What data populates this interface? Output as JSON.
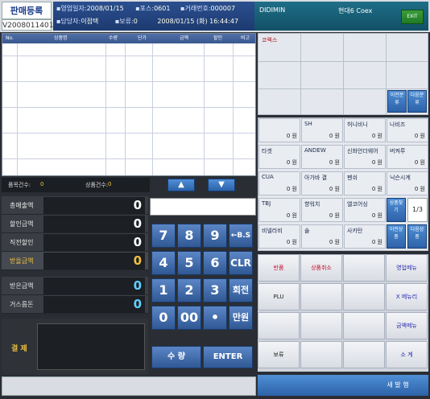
{
  "header": {
    "title": "판매등록",
    "code": "V2008011401",
    "info": [
      {
        "label": "▪영업일자:",
        "value": "2008/01/15"
      },
      {
        "label": "▪포스:",
        "value": "0601"
      },
      {
        "label": "▪거래번호:",
        "value": "000007"
      },
      {
        "label": "▪담당자:",
        "value": "이점택"
      },
      {
        "label": "▪보류:",
        "value": "0"
      },
      {
        "label": "",
        "value": "2008/01/15 (화) 16:44:47"
      }
    ],
    "store": "DIDIMIN",
    "branch": "현대6 Coex",
    "corner_label": "EXIT"
  },
  "table": {
    "columns": [
      "No.",
      "상품명",
      "수량",
      "단가",
      "금액",
      "할인",
      "비고"
    ]
  },
  "counts": {
    "items_label": "품목건수:",
    "items_value": "0",
    "qty_label": "상품건수:",
    "qty_value": "0"
  },
  "amounts": [
    {
      "label": "총매출액",
      "value": "0",
      "color": "#ffffff"
    },
    {
      "label": "할인금액",
      "value": "0",
      "color": "#ffffff"
    },
    {
      "label": "직전할인",
      "value": "0",
      "color": "#ffffff"
    },
    {
      "label": "받을금액",
      "value": "0",
      "color": "#f0c040"
    },
    {
      "label": "받은금액",
      "value": "0",
      "color": "#5fd0ff"
    },
    {
      "label": "거스름돈",
      "value": "0",
      "color": "#5fd0ff"
    }
  ],
  "payment_label": "결 제",
  "keypad": {
    "row1": [
      "7",
      "8",
      "9",
      "←B.S"
    ],
    "row2": [
      "4",
      "5",
      "6",
      "CLR"
    ],
    "row3": [
      "1",
      "2",
      "3",
      "회전"
    ],
    "row4": [
      "0",
      "00",
      "•",
      "만원"
    ],
    "qty": "수 량",
    "enter": "ENTER"
  },
  "category": {
    "title": "코렉스"
  },
  "categorynav": {
    "prev": "이전분류",
    "next": "다음분류"
  },
  "products": [
    [
      "",
      "SH",
      "허니비니",
      "나비즈"
    ],
    [
      "타겟",
      "ANDEW",
      "신화언더웨어",
      "버켜루"
    ],
    [
      "CUA",
      "아가바 결",
      "펜쉬",
      "닉슨시계"
    ],
    [
      "TBJ",
      "향워치",
      "엘코어싱",
      ""
    ],
    [
      "비넬라비",
      "솔",
      "사카탄",
      ""
    ]
  ],
  "product_price": "0 원",
  "pagenav": {
    "prev": "상품찾기",
    "page": "1",
    "total": "3"
  },
  "productnav": {
    "prev": "이전상품",
    "next": "다음상품"
  },
  "functions": [
    [
      "반품",
      "상품취소",
      "",
      "영업메뉴"
    ],
    [
      "PLU",
      "",
      "",
      "X 메뉴리"
    ],
    [
      "",
      "",
      "",
      "금액메뉴"
    ],
    [
      "보류",
      "",
      "",
      "소 계"
    ]
  ],
  "function_colors": [
    "#c8102e",
    "#c8102e",
    "#222222",
    "#2b2bb0"
  ],
  "final_button": "새 발 행",
  "status": ""
}
